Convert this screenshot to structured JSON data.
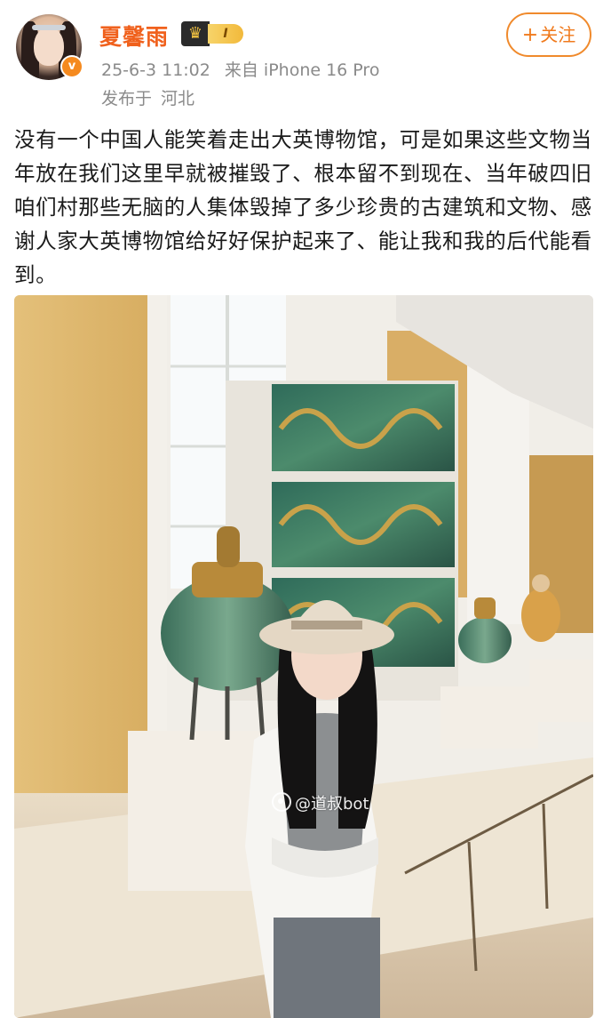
{
  "user": {
    "name": "夏馨雨",
    "vip_level": "I",
    "verified_mark": "v"
  },
  "post": {
    "timestamp": "25-6-3 11:02",
    "source": "来自 iPhone 16 Pro",
    "location_prefix": "发布于",
    "location": "河北",
    "text": "没有一个中国人能笑着走出大英博物馆，可是如果这些文物当年放在我们这里早就被摧毁了、根本留不到现在、当年破四旧咱们村那些无脑的人集体毁掉了多少珍贵的古建筑和文物、感谢人家大英博物馆给好好保护起来了、能让我和我的后代能看到。"
  },
  "follow_button": {
    "plus": "+",
    "label": "关注"
  },
  "photo": {
    "watermark": "@道叔bot"
  },
  "colors": {
    "username": "#f0611d",
    "follow_border": "#f08a2c",
    "meta_text": "#8a8a8a",
    "verified": "#f58a1f"
  },
  "icons": [
    "avatar",
    "verified-icon",
    "vip-crown-icon",
    "plus-icon",
    "weibo-logo-icon"
  ]
}
